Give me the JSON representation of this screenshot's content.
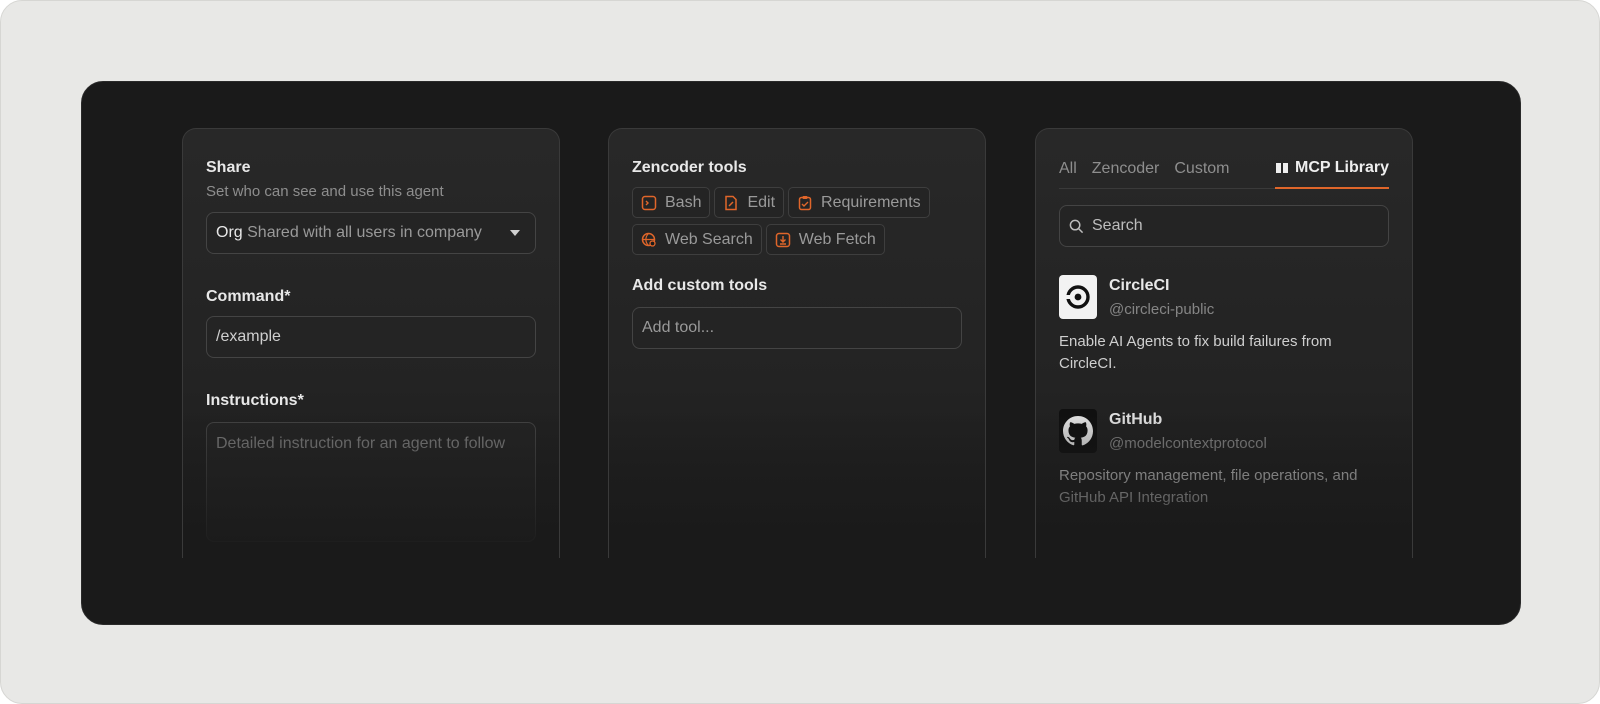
{
  "share_panel": {
    "share_label": "Share",
    "share_sublabel": "Set who can see and use this agent",
    "share_select_value": "Org",
    "share_select_desc": "Shared with all users in company",
    "command_label": "Command*",
    "command_value": "/example",
    "instructions_label": "Instructions*",
    "instructions_placeholder": "Detailed instruction for an agent to follow"
  },
  "tools_panel": {
    "title": "Zencoder tools",
    "tools": [
      {
        "label": "Bash",
        "icon": "terminal-icon"
      },
      {
        "label": "Edit",
        "icon": "file-edit-icon"
      },
      {
        "label": "Requirements",
        "icon": "clipboard-check-icon"
      },
      {
        "label": "Web Search",
        "icon": "globe-search-icon"
      },
      {
        "label": "Web Fetch",
        "icon": "download-icon"
      }
    ],
    "custom_title": "Add custom tools",
    "custom_placeholder": "Add tool..."
  },
  "mcp_panel": {
    "tabs": [
      "All",
      "Zencoder",
      "Custom"
    ],
    "active_tab": "MCP Library",
    "search_placeholder": "Search",
    "items": [
      {
        "name": "CircleCI",
        "handle": "@circleci-public",
        "description": "Enable AI Agents to fix build failures from CircleCI.",
        "icon": "circleci-logo-icon"
      },
      {
        "name": "GitHub",
        "handle": "@modelcontextprotocol",
        "description": "Repository management, file operations, and GitHub API Integration",
        "icon": "github-logo-icon"
      }
    ]
  },
  "colors": {
    "accent": "#e0662a",
    "background": "#1a1a1a",
    "frame": "#e8e8e6"
  }
}
